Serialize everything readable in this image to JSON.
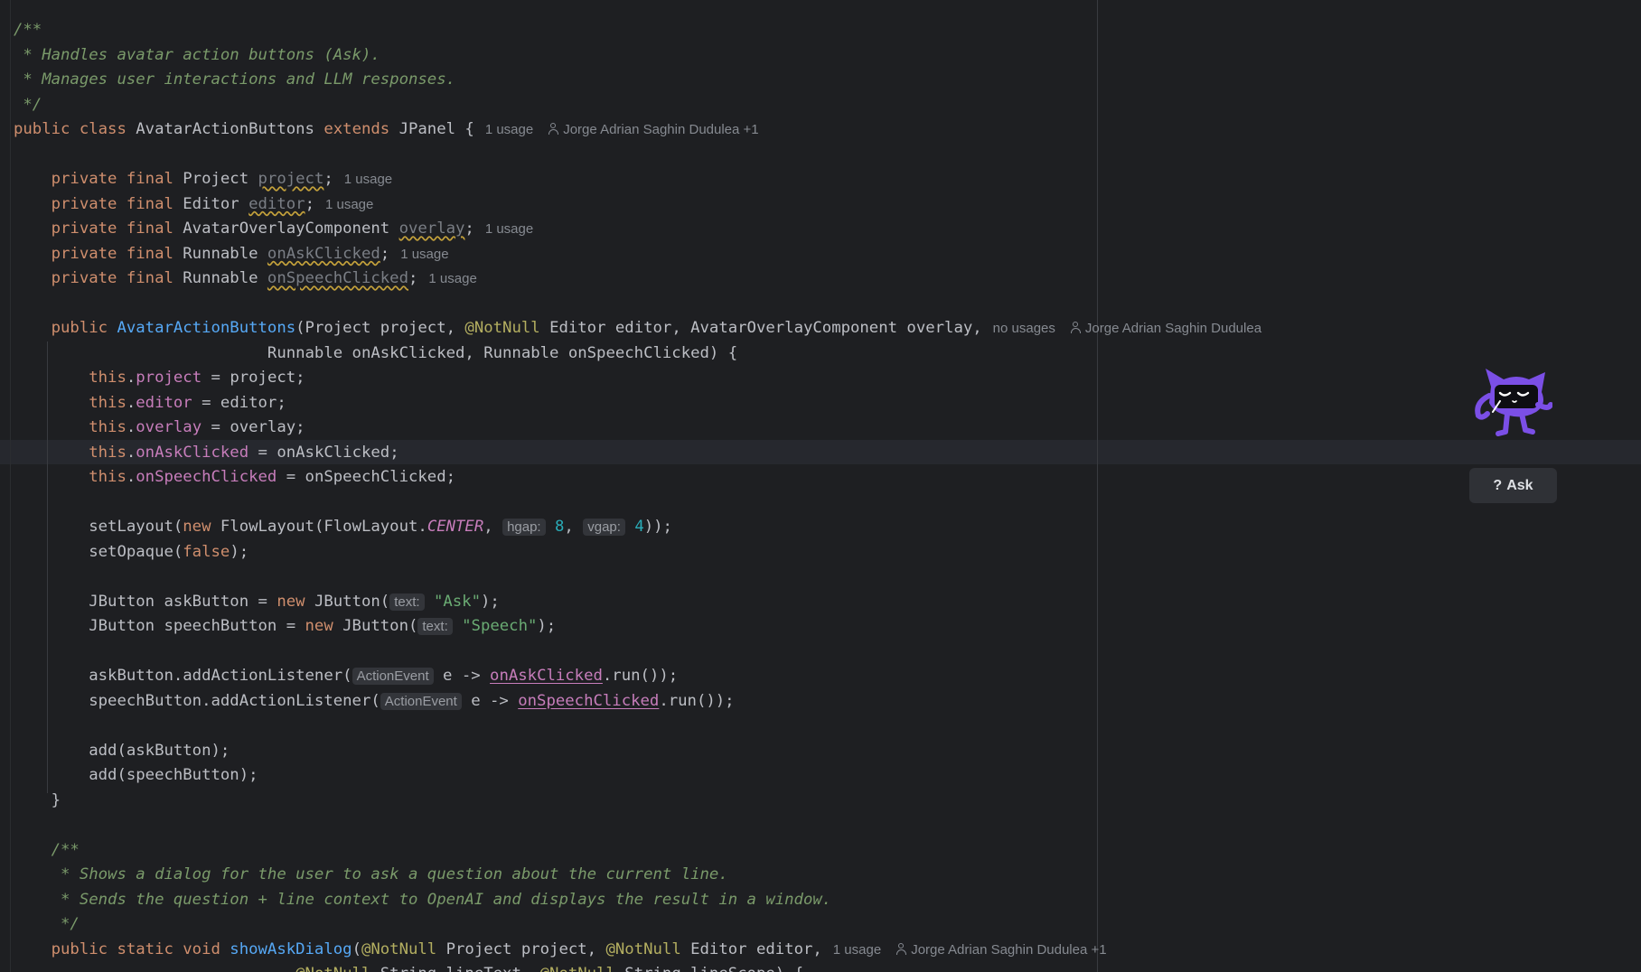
{
  "editor": {
    "lines": [
      [
        {
          "t": "/**",
          "c": "cm"
        }
      ],
      [
        {
          "t": " * Handles avatar action buttons (Ask).",
          "c": "cm"
        }
      ],
      [
        {
          "t": " * Manages user interactions and LLM responses.",
          "c": "cm"
        }
      ],
      [
        {
          "t": " */",
          "c": "cm"
        }
      ],
      [
        {
          "t": "public class ",
          "c": "kw"
        },
        {
          "t": "AvatarActionButtons "
        },
        {
          "t": "extends ",
          "c": "kw"
        },
        {
          "t": "JPanel {"
        },
        {
          "t": "1 usage",
          "c": "hint"
        },
        {
          "t": "Jorge Adrian Saghin Dudulea +1",
          "c": "author"
        }
      ],
      [],
      [
        {
          "t": "    private final ",
          "c": "kw"
        },
        {
          "t": "Project "
        },
        {
          "t": "project",
          "c": "unused"
        },
        {
          "t": ";"
        },
        {
          "t": "1 usage",
          "c": "hint"
        }
      ],
      [
        {
          "t": "    private final ",
          "c": "kw"
        },
        {
          "t": "Editor "
        },
        {
          "t": "editor",
          "c": "unused"
        },
        {
          "t": ";"
        },
        {
          "t": "1 usage",
          "c": "hint"
        }
      ],
      [
        {
          "t": "    private final ",
          "c": "kw"
        },
        {
          "t": "AvatarOverlayComponent "
        },
        {
          "t": "overlay",
          "c": "unused"
        },
        {
          "t": ";"
        },
        {
          "t": "1 usage",
          "c": "hint"
        }
      ],
      [
        {
          "t": "    private final ",
          "c": "kw"
        },
        {
          "t": "Runnable "
        },
        {
          "t": "onAskClicked",
          "c": "unused"
        },
        {
          "t": ";"
        },
        {
          "t": "1 usage",
          "c": "hint"
        }
      ],
      [
        {
          "t": "    private final ",
          "c": "kw"
        },
        {
          "t": "Runnable "
        },
        {
          "t": "onSpeechClicked",
          "c": "unused"
        },
        {
          "t": ";"
        },
        {
          "t": "1 usage",
          "c": "hint"
        }
      ],
      [],
      [
        {
          "t": "    public ",
          "c": "kw"
        },
        {
          "t": "AvatarActionButtons",
          "c": "fn"
        },
        {
          "t": "(Project project, "
        },
        {
          "t": "@NotNull ",
          "c": "ann"
        },
        {
          "t": "Editor editor, AvatarOverlayComponent overlay,"
        },
        {
          "t": "no usages",
          "c": "hint"
        },
        {
          "t": "Jorge Adrian Saghin Dudulea",
          "c": "author"
        }
      ],
      [
        {
          "t": "                           Runnable onAskClicked, Runnable onSpeechClicked) {"
        }
      ],
      [
        {
          "t": "        "
        },
        {
          "t": "this",
          "c": "kw"
        },
        {
          "t": "."
        },
        {
          "t": "project",
          "c": "fld"
        },
        {
          "t": " = project;"
        }
      ],
      [
        {
          "t": "        "
        },
        {
          "t": "this",
          "c": "kw"
        },
        {
          "t": "."
        },
        {
          "t": "editor",
          "c": "fld"
        },
        {
          "t": " = editor;"
        }
      ],
      [
        {
          "t": "        "
        },
        {
          "t": "this",
          "c": "kw"
        },
        {
          "t": "."
        },
        {
          "t": "overlay",
          "c": "fld"
        },
        {
          "t": " = overlay;"
        }
      ],
      [
        {
          "t": "        "
        },
        {
          "t": "this",
          "c": "kw"
        },
        {
          "t": "."
        },
        {
          "t": "onAskClicked",
          "c": "fld"
        },
        {
          "t": " = onAskClicked;"
        }
      ],
      [
        {
          "t": "        "
        },
        {
          "t": "this",
          "c": "kw"
        },
        {
          "t": "."
        },
        {
          "t": "onSpeechClicked",
          "c": "fld"
        },
        {
          "t": " = onSpeechClicked;"
        }
      ],
      [],
      [
        {
          "t": "        setLayout("
        },
        {
          "t": "new ",
          "c": "kw"
        },
        {
          "t": "FlowLayout(FlowLayout."
        },
        {
          "t": "CENTER",
          "c": "cst"
        },
        {
          "t": ", "
        },
        {
          "t": "hgap:",
          "c": "pill"
        },
        {
          "t": " "
        },
        {
          "t": "8",
          "c": "num"
        },
        {
          "t": ", "
        },
        {
          "t": "vgap:",
          "c": "pill"
        },
        {
          "t": " "
        },
        {
          "t": "4",
          "c": "num"
        },
        {
          "t": "));"
        }
      ],
      [
        {
          "t": "        setOpaque("
        },
        {
          "t": "false",
          "c": "kw"
        },
        {
          "t": ");"
        }
      ],
      [],
      [
        {
          "t": "        JButton askButton = "
        },
        {
          "t": "new ",
          "c": "kw"
        },
        {
          "t": "JButton("
        },
        {
          "t": "text:",
          "c": "pill"
        },
        {
          "t": " "
        },
        {
          "t": "\"Ask\"",
          "c": "str"
        },
        {
          "t": ");"
        }
      ],
      [
        {
          "t": "        JButton speechButton = "
        },
        {
          "t": "new ",
          "c": "kw"
        },
        {
          "t": "JButton("
        },
        {
          "t": "text:",
          "c": "pill"
        },
        {
          "t": " "
        },
        {
          "t": "\"Speech\"",
          "c": "str"
        },
        {
          "t": ");"
        }
      ],
      [],
      [
        {
          "t": "        askButton.addActionListener("
        },
        {
          "t": "ActionEvent",
          "c": "pill"
        },
        {
          "t": " e -> "
        },
        {
          "t": "onAskClicked",
          "c": "ref"
        },
        {
          "t": ".run());"
        }
      ],
      [
        {
          "t": "        speechButton.addActionListener("
        },
        {
          "t": "ActionEvent",
          "c": "pill"
        },
        {
          "t": " e -> "
        },
        {
          "t": "onSpeechClicked",
          "c": "ref"
        },
        {
          "t": ".run());"
        }
      ],
      [],
      [
        {
          "t": "        add(askButton);"
        }
      ],
      [
        {
          "t": "        add(speechButton);"
        }
      ],
      [
        {
          "t": "    }"
        }
      ],
      [],
      [
        {
          "t": "    /**",
          "c": "cm"
        }
      ],
      [
        {
          "t": "     * Shows a dialog for the user to ask a question about the current line.",
          "c": "cm"
        }
      ],
      [
        {
          "t": "     * Sends the question + line context to OpenAI and displays the result in a window.",
          "c": "cm"
        }
      ],
      [
        {
          "t": "     */",
          "c": "cm"
        }
      ],
      [
        {
          "t": "    public static void ",
          "c": "kw"
        },
        {
          "t": "showAskDialog",
          "c": "fn"
        },
        {
          "t": "("
        },
        {
          "t": "@NotNull ",
          "c": "ann"
        },
        {
          "t": "Project project, "
        },
        {
          "t": "@NotNull ",
          "c": "ann"
        },
        {
          "t": "Editor editor,"
        },
        {
          "t": "1 usage",
          "c": "hint"
        },
        {
          "t": "Jorge Adrian Saghin Dudulea +1",
          "c": "author"
        }
      ],
      [
        {
          "t": "                              "
        },
        {
          "t": "@NotNull ",
          "c": "ann"
        },
        {
          "t": "String lineText, "
        },
        {
          "t": "@NotNull ",
          "c": "ann"
        },
        {
          "t": "String lineScope) {"
        }
      ]
    ]
  },
  "overlay": {
    "mascot_icon": "cat-mascot-icon",
    "ask_button": {
      "icon": "?",
      "label": "Ask"
    }
  }
}
